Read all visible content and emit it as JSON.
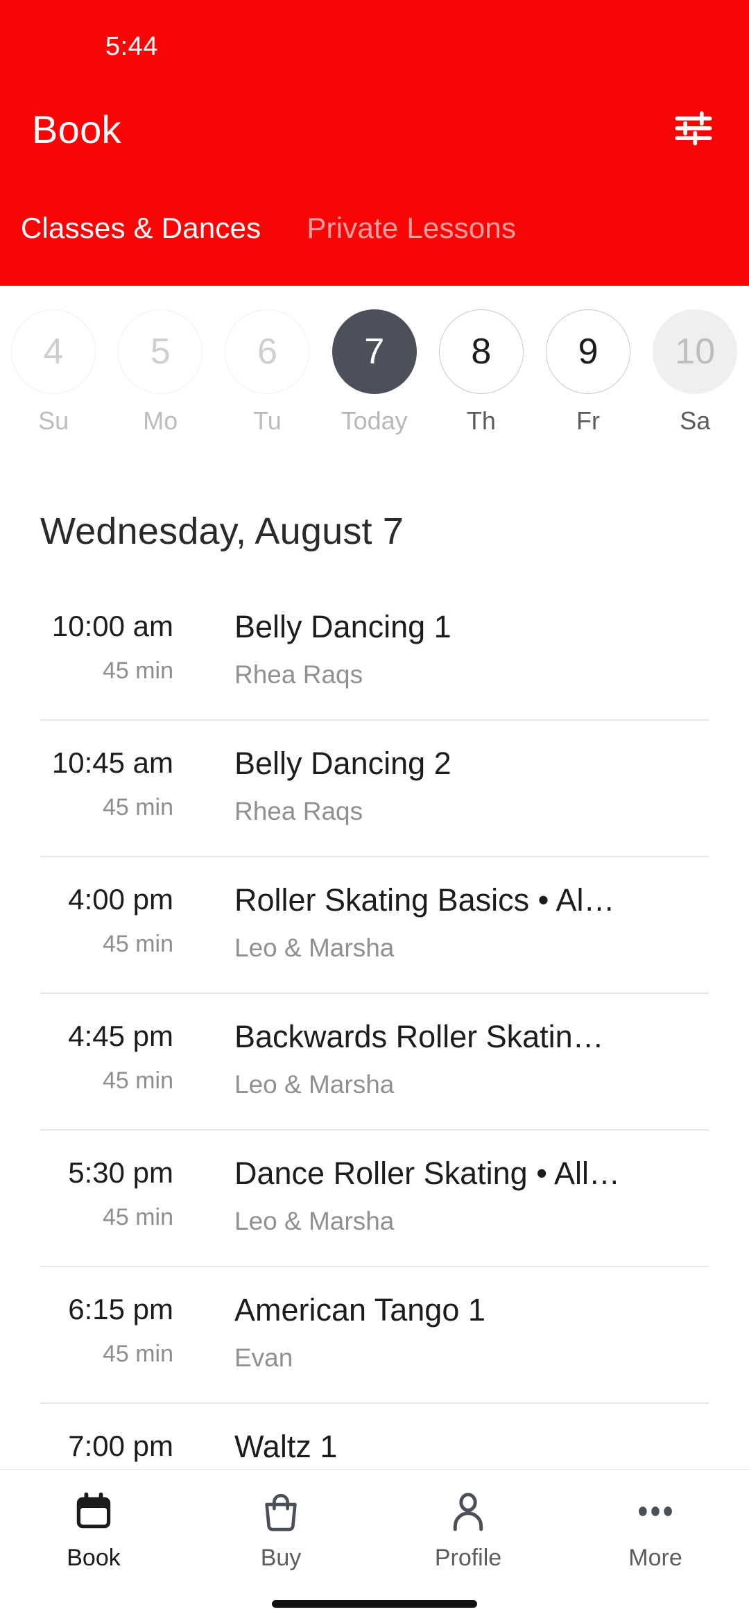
{
  "status_bar": {
    "time": "5:44"
  },
  "header": {
    "title": "Book",
    "filter_icon": "sliders-filter-icon",
    "bg_color": "#fa0505",
    "tabs": [
      {
        "label": "Classes & Dances",
        "active": true
      },
      {
        "label": "Private Lessons",
        "active": false
      }
    ]
  },
  "date_strip": {
    "days": [
      {
        "num": "4",
        "weekday": "Su",
        "state": "disabled"
      },
      {
        "num": "5",
        "weekday": "Mo",
        "state": "disabled"
      },
      {
        "num": "6",
        "weekday": "Tu",
        "state": "disabled"
      },
      {
        "num": "7",
        "weekday": "Today",
        "state": "selected"
      },
      {
        "num": "8",
        "weekday": "Th",
        "state": "open"
      },
      {
        "num": "9",
        "weekday": "Fr",
        "state": "open"
      },
      {
        "num": "10",
        "weekday": "Sa",
        "state": "muted"
      }
    ],
    "selected_color": "#4c505b"
  },
  "schedule": {
    "date_heading": "Wednesday, August 7",
    "classes": [
      {
        "time": "10:00 am",
        "duration": "45 min",
        "title": "Belly Dancing 1",
        "instructor": "Rhea Raqs"
      },
      {
        "time": "10:45 am",
        "duration": "45 min",
        "title": "Belly Dancing 2",
        "instructor": "Rhea Raqs"
      },
      {
        "time": "4:00 pm",
        "duration": "45 min",
        "title": "Roller Skating Basics • Al…",
        "instructor": "Leo & Marsha"
      },
      {
        "time": "4:45 pm",
        "duration": "45 min",
        "title": "Backwards Roller Skatin…",
        "instructor": "Leo & Marsha"
      },
      {
        "time": "5:30 pm",
        "duration": "45 min",
        "title": "Dance Roller Skating • All…",
        "instructor": "Leo & Marsha"
      },
      {
        "time": "6:15 pm",
        "duration": "45 min",
        "title": "American Tango 1",
        "instructor": "Evan"
      },
      {
        "time": "7:00 pm",
        "duration": "",
        "title": "Waltz 1",
        "instructor": ""
      }
    ]
  },
  "tab_bar": {
    "items": [
      {
        "label": "Book",
        "icon": "calendar-icon",
        "active": true
      },
      {
        "label": "Buy",
        "icon": "shopping-bag-icon",
        "active": false
      },
      {
        "label": "Profile",
        "icon": "person-icon",
        "active": false
      },
      {
        "label": "More",
        "icon": "ellipsis-icon",
        "active": false
      }
    ]
  }
}
